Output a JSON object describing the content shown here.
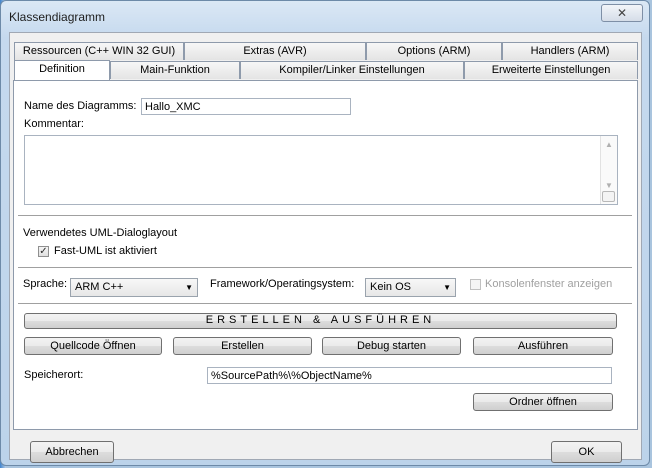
{
  "window": {
    "title": "Klassendiagramm",
    "close_glyph": "✕"
  },
  "tabs_back": [
    "Ressourcen (C++ WIN 32 GUI)",
    "Extras (AVR)",
    "Options (ARM)",
    "Handlers (ARM)"
  ],
  "tabs_front": [
    "Definition",
    "Main-Funktion",
    "Kompiler/Linker Einstellungen",
    "Erweiterte Einstellungen"
  ],
  "definition": {
    "name_label": "Name des Diagramms:",
    "name_value": "Hallo_XMC",
    "comment_label": "Kommentar:",
    "comment_value": "",
    "uml_section_label": "Verwendetes UML-Dialoglayout",
    "fast_uml_label": "Fast-UML ist aktiviert",
    "fast_uml_checked": "✓",
    "language_label": "Sprache:",
    "language_value": "ARM C++",
    "framework_label": "Framework/Operatingsystem:",
    "framework_value": "Kein OS",
    "console_label": "Konsolenfenster anzeigen",
    "build_run_button": "ERSTELLEN & AUSFÜHREN",
    "open_source_button": "Quellcode Öffnen",
    "build_button": "Erstellen",
    "debug_button": "Debug starten",
    "run_button": "Ausführen",
    "location_label": "Speicherort:",
    "location_value": "%SourcePath%\\%ObjectName%",
    "open_folder_button": "Ordner öffnen"
  },
  "footer": {
    "cancel_button": "Abbrechen",
    "ok_button": "OK"
  },
  "icons": {
    "dropdown_arrow": "▼",
    "scroll_up": "▲",
    "scroll_down": "▼"
  }
}
